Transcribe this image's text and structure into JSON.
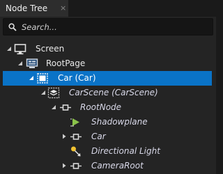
{
  "tab": {
    "title": "Node Tree",
    "close_glyph": "×"
  },
  "search": {
    "placeholder": "Search..."
  },
  "tree": [
    {
      "label": "Screen",
      "icon": "monitor-icon",
      "expanded": true
    },
    {
      "label": "RootPage",
      "icon": "page-icon",
      "expanded": true
    },
    {
      "label": "Car (Car)",
      "icon": "component-icon",
      "expanded": true,
      "selected": true
    },
    {
      "label": "CarScene (CarScene)",
      "icon": "scene-icon",
      "expanded": true
    },
    {
      "label": "RootNode",
      "icon": "node-icon",
      "expanded": true
    },
    {
      "label": "Shadowplane",
      "icon": "model-icon"
    },
    {
      "label": "Car",
      "icon": "node-icon",
      "collapsed": true
    },
    {
      "label": "Directional Light",
      "icon": "light-icon"
    },
    {
      "label": "CameraRoot",
      "icon": "node-icon",
      "collapsed": true
    }
  ],
  "colors": {
    "selection": "#0a73c7",
    "panel": "#242424",
    "tab": "#2d2d2d"
  }
}
